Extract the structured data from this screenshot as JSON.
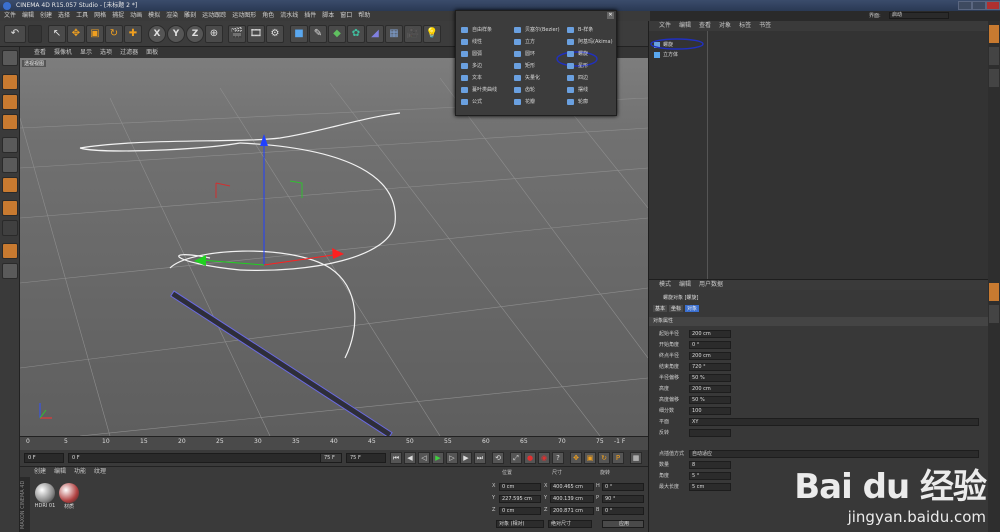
{
  "title_bar": {
    "title": "CINEMA 4D R15.057 Studio - [未标题 2 *]"
  },
  "menu_bar": [
    "文件",
    "编辑",
    "创建",
    "选择",
    "工具",
    "网格",
    "捕捉",
    "动画",
    "模拟",
    "渲染",
    "雕刻",
    "运动跟踪",
    "运动图形",
    "角色",
    "流水线",
    "插件",
    "脚本",
    "窗口",
    "帮助"
  ],
  "toolbar": {
    "axis_x": "X",
    "axis_y": "Y",
    "axis_z": "Z"
  },
  "viewport": {
    "menu": [
      "查看",
      "摄像机",
      "显示",
      "选项",
      "过滤器",
      "面板"
    ],
    "label": "透视视图"
  },
  "spline_popup": {
    "items": [
      {
        "label": "自由样条",
        "color": "#6aa0e0"
      },
      {
        "label": "贝塞尔(Bezier)",
        "color": "#6aa0e0"
      },
      {
        "label": "B-样条",
        "color": "#6aa0e0"
      },
      {
        "label": "线性",
        "color": "#6aa0e0"
      },
      {
        "label": "立方",
        "color": "#6aa0e0"
      },
      {
        "label": "阿基玛(Akima)",
        "color": "#6aa0e0"
      },
      {
        "label": "圆弧",
        "color": "#6aa0e0"
      },
      {
        "label": "圆环",
        "color": "#6aa0e0"
      },
      {
        "label": "螺旋",
        "color": "#6aa0e0"
      },
      {
        "label": "多边",
        "color": "#6aa0e0"
      },
      {
        "label": "矩形",
        "color": "#6aa0e0"
      },
      {
        "label": "星形",
        "color": "#6aa0e0"
      },
      {
        "label": "文本",
        "color": "#6aa0e0"
      },
      {
        "label": "矢量化",
        "color": "#6aa0e0"
      },
      {
        "label": "四边",
        "color": "#6aa0e0"
      },
      {
        "label": "蔓叶类曲线",
        "color": "#6aa0e0"
      },
      {
        "label": "齿轮",
        "color": "#6aa0e0"
      },
      {
        "label": "摆线",
        "color": "#6aa0e0"
      },
      {
        "label": "公式",
        "color": "#6aa0e0"
      },
      {
        "label": "花瓣",
        "color": "#6aa0e0"
      },
      {
        "label": "轮廓",
        "color": "#6aa0e0"
      }
    ]
  },
  "timeline": {
    "ticks": [
      "0",
      "5",
      "10",
      "15",
      "20",
      "25",
      "30",
      "35",
      "40",
      "45",
      "50",
      "55",
      "60",
      "65",
      "70",
      "75"
    ],
    "end_label": "-1 F"
  },
  "playbar": {
    "start": "0 F",
    "current": "0 F",
    "end": "75 F",
    "end2": "75 F"
  },
  "materials": {
    "menu": [
      "创建",
      "编辑",
      "功能",
      "纹理"
    ],
    "items": [
      {
        "label": "HDRI 01",
        "color": "#888888"
      },
      {
        "label": "材质",
        "color": "#b04040"
      }
    ],
    "brand": "MAXON CINEMA 4D"
  },
  "coordinates": {
    "headers": [
      "位置",
      "尺寸",
      "旋转"
    ],
    "rows": [
      {
        "axis": "X",
        "pos": "0 cm",
        "size": "400.465 cm",
        "rot_axis": "H",
        "rot": "0 °"
      },
      {
        "axis": "Y",
        "pos": "227.595 cm",
        "size": "400.139 cm",
        "rot_axis": "P",
        "rot": "90 °"
      },
      {
        "axis": "Z",
        "pos": "0 cm",
        "size": "200.871 cm",
        "rot_axis": "B",
        "rot": "0 °"
      }
    ],
    "mode1": "对象 (相对)",
    "mode2": "绝对尺寸",
    "apply": "应用"
  },
  "object_manager": {
    "layout_label": "界面:",
    "layout_value": "启动",
    "menu": [
      "文件",
      "编辑",
      "查看",
      "对象",
      "标签",
      "书签"
    ],
    "objects": [
      {
        "name": "螺旋"
      },
      {
        "name": "立方体"
      }
    ]
  },
  "attributes": {
    "menu": [
      "模式",
      "编辑",
      "用户数据"
    ],
    "object_title": "螺旋对象 [螺旋]",
    "tabs": [
      "基本",
      "坐标",
      "对象"
    ],
    "section": "对象属性",
    "fields": [
      {
        "label": "起始半径",
        "value": "200 cm"
      },
      {
        "label": "开始角度",
        "value": "0 °"
      },
      {
        "label": "终点半径",
        "value": "200 cm"
      },
      {
        "label": "结束角度",
        "value": "720 °"
      },
      {
        "label": "半径偏移",
        "value": "50 %"
      },
      {
        "label": "高度",
        "value": "200 cm"
      },
      {
        "label": "高度偏移",
        "value": "50 %"
      },
      {
        "label": "细分数",
        "value": "100"
      },
      {
        "label": "平面",
        "value": "XY"
      },
      {
        "label": "反转",
        "value": ""
      }
    ],
    "interp_label": "点插值方式",
    "interp_value": "自动适应",
    "extra": [
      {
        "label": "数量",
        "value": "8"
      },
      {
        "label": "角度",
        "value": "5 °"
      },
      {
        "label": "最大长度",
        "value": "5 cm"
      }
    ]
  },
  "watermark": {
    "logo": "Bai du 经验",
    "url": "jingyan.baidu.com"
  }
}
